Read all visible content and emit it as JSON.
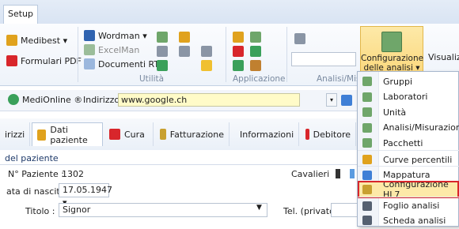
{
  "tabbar": {
    "setup_tab": "Setup"
  },
  "ribbon": {
    "medibest": "Medibest ▾",
    "formulari_pdf": "Formulari PDF",
    "wordman": "Wordman ▾",
    "excelman": "ExcelMan",
    "documenti_rtf": "Documenti RTF",
    "group_utilita": "Utilità",
    "group_applicazione": "Applicazione",
    "group_analisi": "Analisi/Mis",
    "configurazione_line1": "Configurazione",
    "configurazione_line2": "delle analisi ▾",
    "visualizza": "Visualiz"
  },
  "addressbar": {
    "medionline": "MediOnline ®",
    "indirizzo_label": "Indirizzo",
    "url": "www.google.ch"
  },
  "navtabs": {
    "indirizzi": "irizzi",
    "dati_paziente": "Dati paziente",
    "cura": "Cura",
    "fatturazione": "Fatturazione",
    "informazioni": "Informazioni",
    "debitore": "Debitore"
  },
  "form": {
    "section_title": "del paziente",
    "paziente_label": "N° Paziente :",
    "paziente_value": "1302",
    "nascita_label": "ata di nascita :",
    "nascita_value": "17.05.1947 ▾",
    "titolo_label": "Titolo :",
    "titolo_value": "Signor",
    "cavalieri_label": "Cavalieri",
    "tel_label": "Tel. (privato) :"
  },
  "menu": {
    "items": [
      {
        "label": "Gruppi",
        "icon": "document-icon",
        "color": "#6fa66a"
      },
      {
        "label": "Laboratori",
        "icon": "document-icon",
        "color": "#6fa66a"
      },
      {
        "label": "Unità",
        "icon": "document-icon",
        "color": "#6fa66a"
      },
      {
        "label": "Analisi/Misurazioni",
        "icon": "document-icon",
        "color": "#6fa66a"
      },
      {
        "label": "Pacchetti",
        "icon": "document-icon",
        "color": "#6fa66a"
      },
      {
        "label": "Curve percentili",
        "icon": "person-icon",
        "color": "#e0a21d"
      },
      {
        "label": "Mappatura",
        "icon": "map-icon",
        "color": "#3f7fd6"
      },
      {
        "label": "Configurazione HL7",
        "icon": "db-icon",
        "color": "#c8a030"
      },
      {
        "label": "Foglio analisi",
        "icon": "binoculars-icon",
        "color": "#556070"
      },
      {
        "label": "Scheda analisi",
        "icon": "binoculars-icon",
        "color": "#556070"
      }
    ],
    "selected_index": 7
  }
}
